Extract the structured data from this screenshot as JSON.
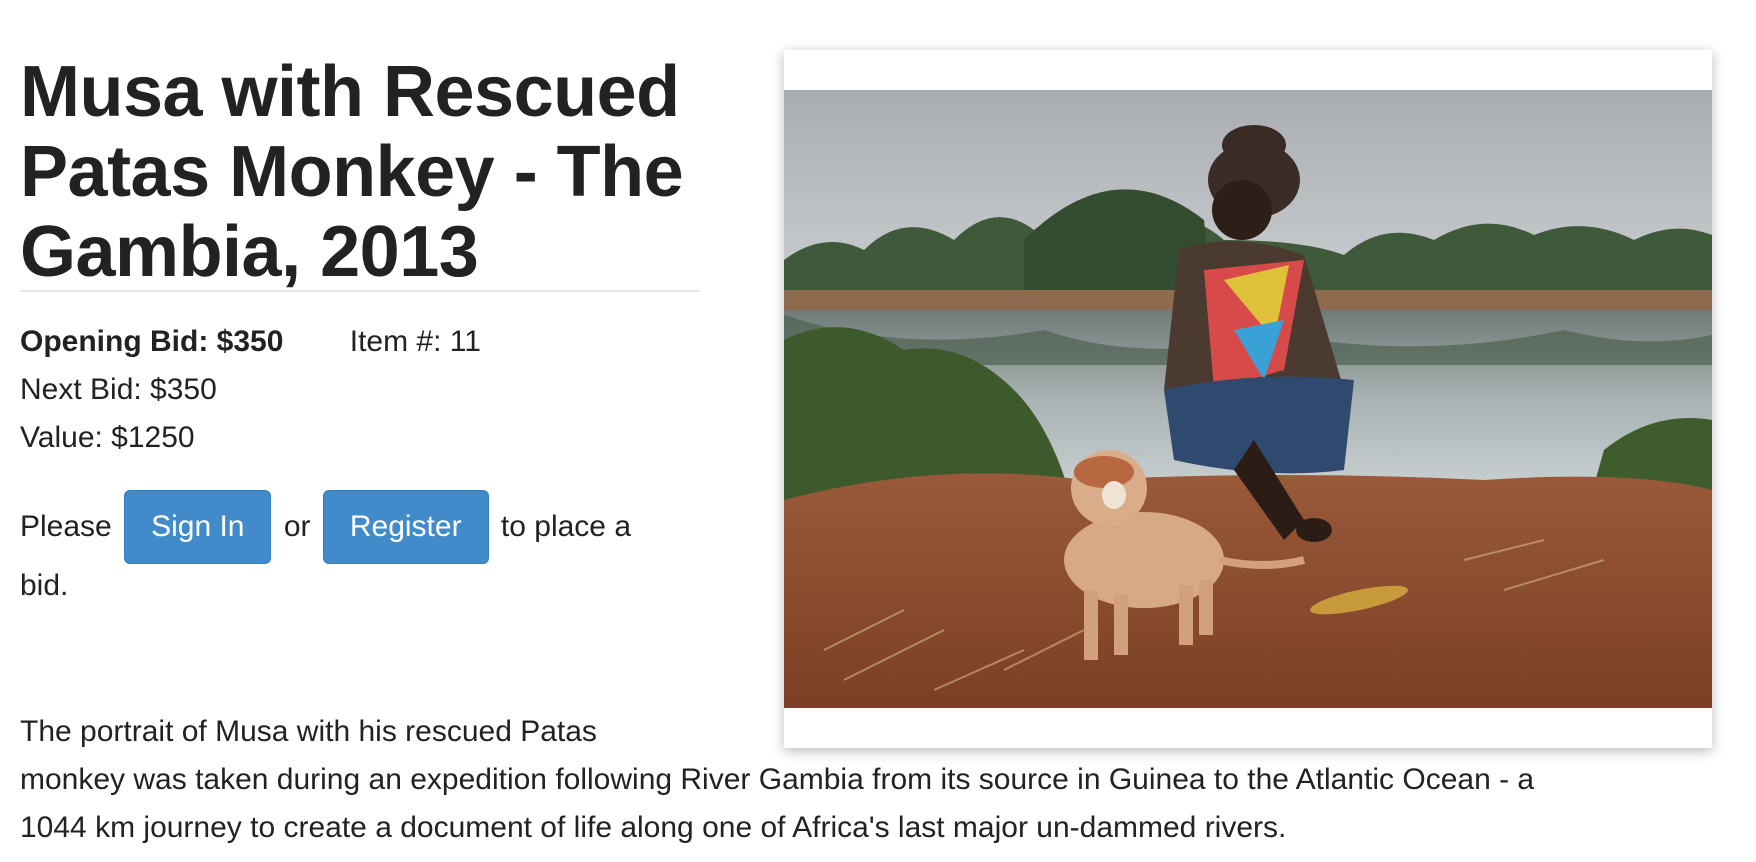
{
  "item": {
    "title": "Musa with Rescued Patas Monkey - The Gambia, 2013",
    "opening_bid": "Opening Bid: $350",
    "item_number": "Item #: 11",
    "next_bid": "Next Bid: $350",
    "value": "Value: $1250"
  },
  "auth": {
    "please": "Please",
    "sign_in_label": "Sign In",
    "or": "or",
    "register_label": "Register",
    "suffix": "to place a",
    "suffix_end": "bid."
  },
  "description": {
    "line1": "The portrait of Musa with his rescued Patas",
    "line2": "monkey was taken during an expedition following River Gambia from its source in Guinea to the Atlantic Ocean - a",
    "line3": "1044 km journey to create a document of life along one of Africa's last major un-dammed rivers."
  }
}
